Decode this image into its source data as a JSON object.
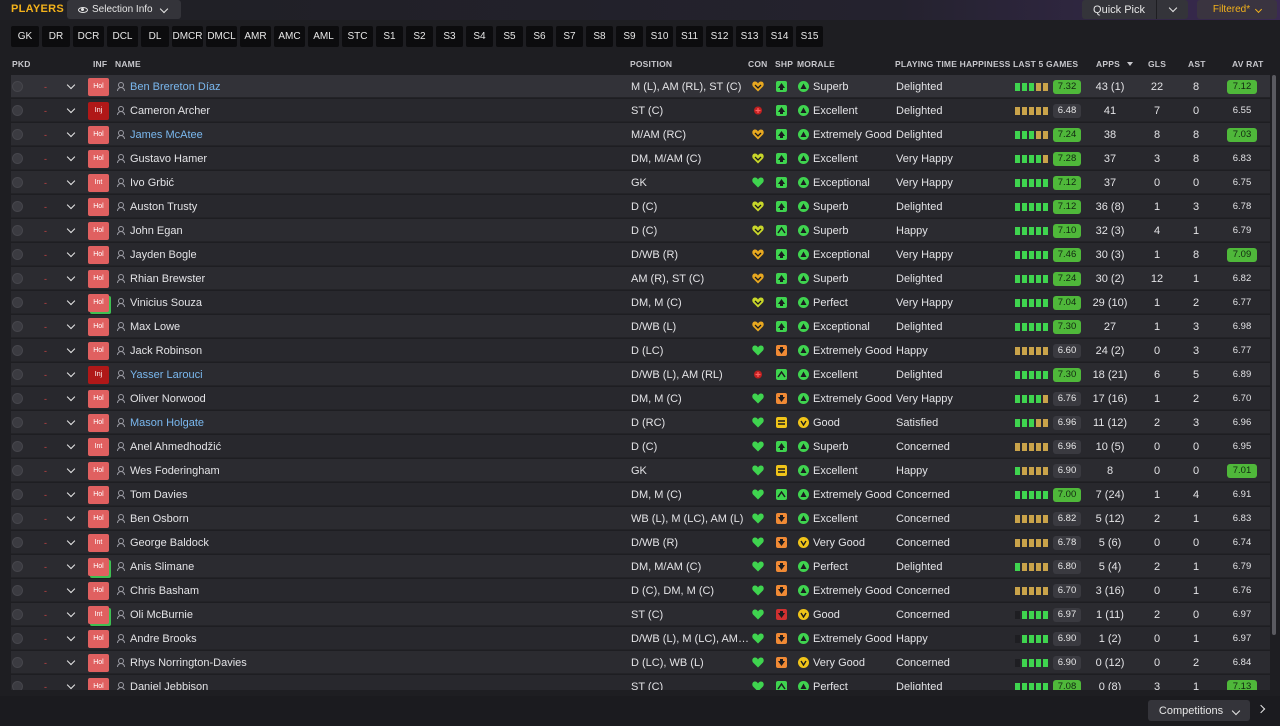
{
  "header": {
    "title": "PLAYERS",
    "selection_info": "Selection Info",
    "quick_pick": "Quick Pick",
    "filtered": "Filtered*"
  },
  "positions": [
    "GK",
    "DR",
    "DCR",
    "DCL",
    "DL",
    "DMCR",
    "DMCL",
    "AMR",
    "AMC",
    "AML",
    "STC",
    "S1",
    "S2",
    "S3",
    "S4",
    "S5",
    "S6",
    "S7",
    "S8",
    "S9",
    "S10",
    "S11",
    "S12",
    "S13",
    "S14",
    "S15"
  ],
  "columns": {
    "pkd": "PKD",
    "inf": "INF",
    "name": "NAME",
    "position": "POSITION",
    "con": "CON",
    "shp": "SHP",
    "morale": "MORALE",
    "pth": "PLAYING TIME HAPPINESS",
    "last5": "LAST 5 GAMES",
    "apps": "APPS",
    "gls": "GLS",
    "ast": "AST",
    "avrat": "AV RAT"
  },
  "colors": {
    "accent": "#f3b21b",
    "link": "#7ab8ef",
    "green_bright": "#3fd44f",
    "green_rating": "#2f9a38",
    "yellow": "#f0c419",
    "orange": "#f08a35",
    "red": "#d03030"
  },
  "players": [
    {
      "inf": "Hol",
      "name": "Ben Brereton Díaz",
      "link": true,
      "position": "M (L), AM (RL), ST (C)",
      "con": "yellow",
      "shp": {
        "color": "#3fd44f",
        "dir": "up"
      },
      "morale": {
        "label": "Superb",
        "level": "high"
      },
      "pth": "Delighted",
      "last5": [
        "g",
        "g",
        "g",
        "y",
        "y"
      ],
      "l5rating": "7.32",
      "l5high": true,
      "apps": "43 (1)",
      "gls": "22",
      "ast": "8",
      "avrat": "7.12",
      "avhigh": true
    },
    {
      "inf": "Inj",
      "name": "Cameron Archer",
      "link": false,
      "position": "ST (C)",
      "con": "injured",
      "shp": {
        "color": "#3fd44f",
        "dir": "up"
      },
      "morale": {
        "label": "Excellent",
        "level": "high"
      },
      "pth": "Delighted",
      "last5": [
        "y",
        "y",
        "y",
        "y",
        "y"
      ],
      "l5rating": "6.48",
      "l5high": false,
      "apps": "41",
      "gls": "7",
      "ast": "0",
      "avrat": "6.55",
      "avhigh": false
    },
    {
      "inf": "Hol",
      "name": "James McAtee",
      "link": true,
      "position": "M/AM (RC)",
      "con": "yellow",
      "shp": {
        "color": "#3fd44f",
        "dir": "up"
      },
      "morale": {
        "label": "Extremely Good",
        "level": "high"
      },
      "pth": "Delighted",
      "last5": [
        "g",
        "g",
        "g",
        "y",
        "y"
      ],
      "l5rating": "7.24",
      "l5high": true,
      "apps": "38",
      "gls": "8",
      "ast": "8",
      "avrat": "7.03",
      "avhigh": true
    },
    {
      "inf": "Hol",
      "name": "Gustavo Hamer",
      "link": false,
      "position": "DM, M/AM (C)",
      "con": "yellow-green",
      "shp": {
        "color": "#3fd44f",
        "dir": "up"
      },
      "morale": {
        "label": "Excellent",
        "level": "high"
      },
      "pth": "Very Happy",
      "last5": [
        "g",
        "g",
        "g",
        "g",
        "y"
      ],
      "l5rating": "7.28",
      "l5high": true,
      "apps": "37",
      "gls": "3",
      "ast": "8",
      "avrat": "6.83",
      "avhigh": false
    },
    {
      "inf": "Int",
      "name": "Ivo Grbić",
      "link": false,
      "position": "GK",
      "con": "green",
      "shp": {
        "color": "#3fd44f",
        "dir": "up"
      },
      "morale": {
        "label": "Exceptional",
        "level": "high"
      },
      "pth": "Very Happy",
      "last5": [
        "g",
        "g",
        "g",
        "g",
        "g"
      ],
      "l5rating": "7.12",
      "l5high": true,
      "apps": "37",
      "gls": "0",
      "ast": "0",
      "avrat": "6.75",
      "avhigh": false
    },
    {
      "inf": "Hol",
      "name": "Auston Trusty",
      "link": false,
      "position": "D (C)",
      "con": "yellow-green",
      "shp": {
        "color": "#3fd44f",
        "dir": "up"
      },
      "morale": {
        "label": "Superb",
        "level": "high"
      },
      "pth": "Delighted",
      "last5": [
        "g",
        "g",
        "g",
        "g",
        "g"
      ],
      "l5rating": "7.12",
      "l5high": true,
      "apps": "36 (8)",
      "gls": "1",
      "ast": "3",
      "avrat": "6.78",
      "avhigh": false
    },
    {
      "inf": "Hol",
      "name": "John Egan",
      "link": false,
      "position": "D (C)",
      "con": "yellow-green",
      "shp": {
        "color": "#3fd44f",
        "dir": "up-soft"
      },
      "morale": {
        "label": "Superb",
        "level": "high"
      },
      "pth": "Happy",
      "last5": [
        "g",
        "g",
        "g",
        "g",
        "g"
      ],
      "l5rating": "7.10",
      "l5high": true,
      "apps": "32 (3)",
      "gls": "4",
      "ast": "1",
      "avrat": "6.79",
      "avhigh": false
    },
    {
      "inf": "Hol",
      "name": "Jayden Bogle",
      "link": false,
      "position": "D/WB (R)",
      "con": "yellow",
      "shp": {
        "color": "#3fd44f",
        "dir": "up"
      },
      "morale": {
        "label": "Exceptional",
        "level": "high"
      },
      "pth": "Very Happy",
      "last5": [
        "g",
        "g",
        "g",
        "g",
        "g"
      ],
      "l5rating": "7.46",
      "l5high": true,
      "apps": "30 (3)",
      "gls": "1",
      "ast": "8",
      "avrat": "7.09",
      "avhigh": true
    },
    {
      "inf": "Hol",
      "name": "Rhian Brewster",
      "link": false,
      "position": "AM (R), ST (C)",
      "con": "yellow",
      "shp": {
        "color": "#3fd44f",
        "dir": "up"
      },
      "morale": {
        "label": "Superb",
        "level": "high"
      },
      "pth": "Delighted",
      "last5": [
        "g",
        "g",
        "g",
        "g",
        "g"
      ],
      "l5rating": "7.24",
      "l5high": true,
      "apps": "30 (2)",
      "gls": "12",
      "ast": "1",
      "avrat": "6.82",
      "avhigh": false
    },
    {
      "inf": "Hol",
      "name": "Vinicius Souza",
      "link": false,
      "position": "DM, M (C)",
      "con": "yellow-green",
      "shp": {
        "color": "#3fd44f",
        "dir": "up"
      },
      "morale": {
        "label": "Perfect",
        "level": "high"
      },
      "pth": "Very Happy",
      "last5": [
        "g",
        "g",
        "g",
        "g",
        "g"
      ],
      "l5rating": "7.04",
      "l5high": true,
      "apps": "29 (10)",
      "gls": "1",
      "ast": "2",
      "avrat": "6.77",
      "avhigh": false,
      "infgreen": true
    },
    {
      "inf": "Hol",
      "name": "Max Lowe",
      "link": false,
      "position": "D/WB (L)",
      "con": "yellow",
      "shp": {
        "color": "#3fd44f",
        "dir": "up"
      },
      "morale": {
        "label": "Exceptional",
        "level": "high"
      },
      "pth": "Delighted",
      "last5": [
        "g",
        "g",
        "g",
        "g",
        "g"
      ],
      "l5rating": "7.30",
      "l5high": true,
      "apps": "27",
      "gls": "1",
      "ast": "3",
      "avrat": "6.98",
      "avhigh": false
    },
    {
      "inf": "Hol",
      "name": "Jack Robinson",
      "link": false,
      "position": "D (LC)",
      "con": "green",
      "shp": {
        "color": "#f08a35",
        "dir": "down"
      },
      "morale": {
        "label": "Extremely Good",
        "level": "high"
      },
      "pth": "Happy",
      "last5": [
        "y",
        "y",
        "y",
        "y",
        "y"
      ],
      "l5rating": "6.60",
      "l5high": false,
      "apps": "24 (2)",
      "gls": "0",
      "ast": "3",
      "avrat": "6.77",
      "avhigh": false
    },
    {
      "inf": "Inj",
      "name": "Yasser Larouci",
      "link": true,
      "position": "D/WB (L), AM (RL)",
      "con": "injured",
      "shp": {
        "color": "#3fd44f",
        "dir": "up-soft"
      },
      "morale": {
        "label": "Excellent",
        "level": "high"
      },
      "pth": "Delighted",
      "last5": [
        "g",
        "g",
        "g",
        "g",
        "g"
      ],
      "l5rating": "7.30",
      "l5high": true,
      "apps": "18 (21)",
      "gls": "6",
      "ast": "5",
      "avrat": "6.89",
      "avhigh": false
    },
    {
      "inf": "Hol",
      "name": "Oliver Norwood",
      "link": false,
      "position": "DM, M (C)",
      "con": "green",
      "shp": {
        "color": "#f08a35",
        "dir": "down"
      },
      "morale": {
        "label": "Extremely Good",
        "level": "high"
      },
      "pth": "Very Happy",
      "last5": [
        "g",
        "g",
        "g",
        "g",
        "y"
      ],
      "l5rating": "6.76",
      "l5high": false,
      "apps": "17 (16)",
      "gls": "1",
      "ast": "2",
      "avrat": "6.70",
      "avhigh": false
    },
    {
      "inf": "Hol",
      "name": "Mason Holgate",
      "link": true,
      "position": "D (RC)",
      "con": "green",
      "shp": {
        "color": "#f0c419",
        "dir": "flat"
      },
      "morale": {
        "label": "Good",
        "level": "mid"
      },
      "pth": "Satisfied",
      "last5": [
        "g",
        "g",
        "g",
        "y",
        "y"
      ],
      "l5rating": "6.96",
      "l5high": false,
      "apps": "11 (12)",
      "gls": "2",
      "ast": "3",
      "avrat": "6.96",
      "avhigh": false
    },
    {
      "inf": "Int",
      "name": "Anel Ahmedhodžić",
      "link": false,
      "position": "D (C)",
      "con": "green",
      "shp": {
        "color": "#3fd44f",
        "dir": "up"
      },
      "morale": {
        "label": "Superb",
        "level": "high"
      },
      "pth": "Concerned",
      "last5": [
        "y",
        "y",
        "y",
        "y",
        "y"
      ],
      "l5rating": "6.96",
      "l5high": false,
      "apps": "10 (5)",
      "gls": "0",
      "ast": "0",
      "avrat": "6.95",
      "avhigh": false
    },
    {
      "inf": "Hol",
      "name": "Wes Foderingham",
      "link": false,
      "position": "GK",
      "con": "green",
      "shp": {
        "color": "#f0c419",
        "dir": "flat"
      },
      "morale": {
        "label": "Excellent",
        "level": "high"
      },
      "pth": "Happy",
      "last5": [
        "g",
        "y",
        "y",
        "y",
        "y"
      ],
      "l5rating": "6.90",
      "l5high": false,
      "apps": "8",
      "gls": "0",
      "ast": "0",
      "avrat": "7.01",
      "avhigh": true
    },
    {
      "inf": "Hol",
      "name": "Tom Davies",
      "link": false,
      "position": "DM, M (C)",
      "con": "green",
      "shp": {
        "color": "#3fd44f",
        "dir": "up-soft"
      },
      "morale": {
        "label": "Extremely Good",
        "level": "high"
      },
      "pth": "Concerned",
      "last5": [
        "g",
        "g",
        "g",
        "g",
        "g"
      ],
      "l5rating": "7.00",
      "l5high": true,
      "apps": "7 (24)",
      "gls": "1",
      "ast": "4",
      "avrat": "6.91",
      "avhigh": false
    },
    {
      "inf": "Hol",
      "name": "Ben Osborn",
      "link": false,
      "position": "WB (L), M (LC), AM (L)",
      "con": "green",
      "shp": {
        "color": "#f08a35",
        "dir": "down"
      },
      "morale": {
        "label": "Excellent",
        "level": "high"
      },
      "pth": "Concerned",
      "last5": [
        "y",
        "y",
        "y",
        "y",
        "y"
      ],
      "l5rating": "6.82",
      "l5high": false,
      "apps": "5 (12)",
      "gls": "2",
      "ast": "1",
      "avrat": "6.83",
      "avhigh": false
    },
    {
      "inf": "Int",
      "name": "George Baldock",
      "link": false,
      "position": "D/WB (R)",
      "con": "green",
      "shp": {
        "color": "#f08a35",
        "dir": "down"
      },
      "morale": {
        "label": "Very Good",
        "level": "mid"
      },
      "pth": "Concerned",
      "last5": [
        "y",
        "y",
        "y",
        "y",
        "y"
      ],
      "l5rating": "6.78",
      "l5high": false,
      "apps": "5 (6)",
      "gls": "0",
      "ast": "0",
      "avrat": "6.74",
      "avhigh": false
    },
    {
      "inf": "Hol",
      "name": "Anis Slimane",
      "link": false,
      "position": "DM, M/AM (C)",
      "con": "green",
      "shp": {
        "color": "#f08a35",
        "dir": "down"
      },
      "morale": {
        "label": "Perfect",
        "level": "high"
      },
      "pth": "Delighted",
      "last5": [
        "g",
        "y",
        "y",
        "y",
        "y"
      ],
      "l5rating": "6.80",
      "l5high": false,
      "apps": "5 (4)",
      "gls": "2",
      "ast": "1",
      "avrat": "6.79",
      "avhigh": false,
      "infgreen": true
    },
    {
      "inf": "Hol",
      "name": "Chris Basham",
      "link": false,
      "position": "D (C), DM, M (C)",
      "con": "green",
      "shp": {
        "color": "#f08a35",
        "dir": "down"
      },
      "morale": {
        "label": "Extremely Good",
        "level": "high"
      },
      "pth": "Concerned",
      "last5": [
        "y",
        "y",
        "y",
        "y",
        "y"
      ],
      "l5rating": "6.70",
      "l5high": false,
      "apps": "3 (16)",
      "gls": "0",
      "ast": "1",
      "avrat": "6.76",
      "avhigh": false
    },
    {
      "inf": "Int",
      "name": "Oli McBurnie",
      "link": false,
      "position": "ST (C)",
      "con": "green",
      "shp": {
        "color": "#d03030",
        "dir": "down"
      },
      "morale": {
        "label": "Good",
        "level": "mid"
      },
      "pth": "Concerned",
      "last5": [
        "",
        "g",
        "g",
        "g",
        "g"
      ],
      "l5rating": "6.97",
      "l5high": false,
      "apps": "1 (11)",
      "gls": "2",
      "ast": "0",
      "avrat": "6.97",
      "avhigh": false,
      "infgreen": true
    },
    {
      "inf": "Hol",
      "name": "Andre Brooks",
      "link": false,
      "position": "D/WB (L), M (LC), AM…",
      "con": "green",
      "shp": {
        "color": "#f08a35",
        "dir": "down"
      },
      "morale": {
        "label": "Extremely Good",
        "level": "high"
      },
      "pth": "Happy",
      "last5": [
        "",
        "g",
        "g",
        "g",
        "g"
      ],
      "l5rating": "6.90",
      "l5high": false,
      "apps": "1 (2)",
      "gls": "0",
      "ast": "1",
      "avrat": "6.97",
      "avhigh": false
    },
    {
      "inf": "Hol",
      "name": "Rhys Norrington-Davies",
      "link": false,
      "position": "D (LC), WB (L)",
      "con": "green",
      "shp": {
        "color": "#f08a35",
        "dir": "down"
      },
      "morale": {
        "label": "Very Good",
        "level": "mid"
      },
      "pth": "Concerned",
      "last5": [
        "",
        "g",
        "g",
        "g",
        "g"
      ],
      "l5rating": "6.90",
      "l5high": false,
      "apps": "0 (12)",
      "gls": "0",
      "ast": "2",
      "avrat": "6.84",
      "avhigh": false
    },
    {
      "inf": "Hol",
      "name": "Daniel Jebbison",
      "link": false,
      "position": "ST (C)",
      "con": "green",
      "shp": {
        "color": "#3fd44f",
        "dir": "up-soft"
      },
      "morale": {
        "label": "Perfect",
        "level": "high"
      },
      "pth": "Delighted",
      "last5": [
        "g",
        "g",
        "g",
        "g",
        "g"
      ],
      "l5rating": "7.08",
      "l5high": true,
      "apps": "0 (8)",
      "gls": "3",
      "ast": "1",
      "avrat": "7.13",
      "avhigh": true
    }
  ],
  "footer": {
    "competitions": "Competitions"
  }
}
